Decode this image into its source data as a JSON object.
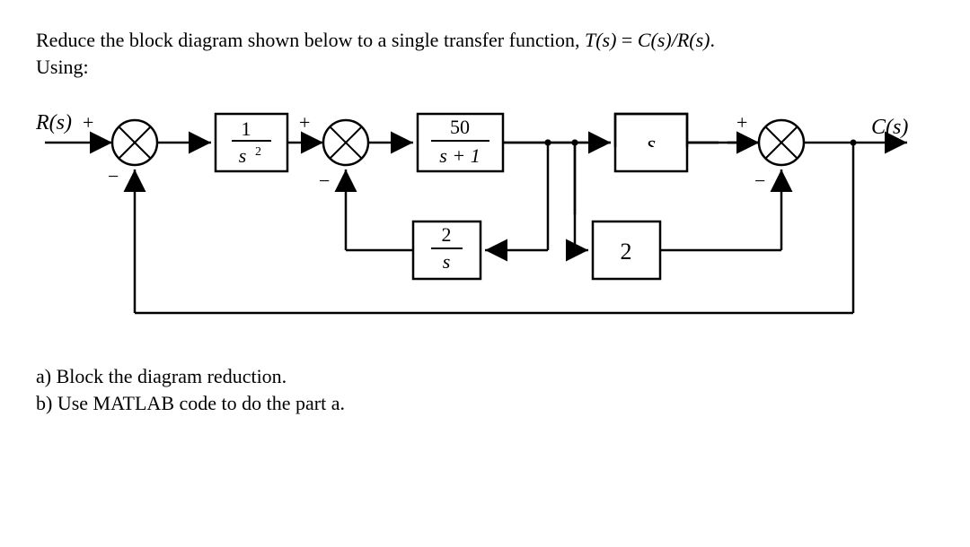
{
  "problem": {
    "line1_prefix": "Reduce the block diagram shown below to a single transfer function, ",
    "line1_eq_lhs": "T(s)",
    "line1_eq_eq": " = ",
    "line1_eq_rhs": "C(s)/R(s)",
    "line1_suffix": ".",
    "line2": "Using:"
  },
  "diagram": {
    "input_label": "R(s)",
    "output_label": "C(s)",
    "sum1_plus": "+",
    "sum1_minus": "−",
    "sum2_plus": "+",
    "sum2_minus": "−",
    "sum3_plus": "+",
    "sum3_minus": "−",
    "block_g1_num": "1",
    "block_g1_den": "s",
    "block_g1_den_exp": "2",
    "block_g2_num": "50",
    "block_g2_den": "s + 1",
    "block_g3": "s",
    "block_h1_num": "2",
    "block_h1_den": "s",
    "block_h2": "2"
  },
  "questions": {
    "a": "a) Block the diagram reduction.",
    "b": "b) Use MATLAB code to do the part a."
  }
}
